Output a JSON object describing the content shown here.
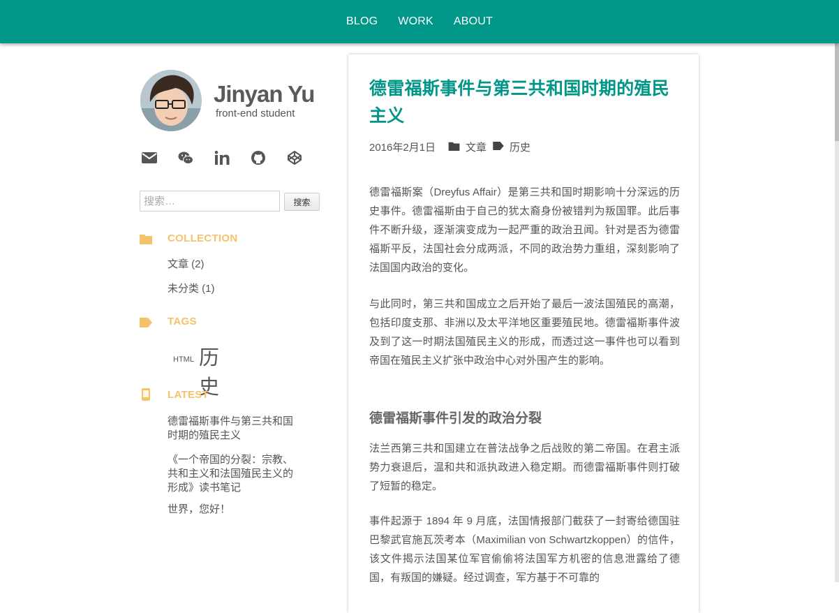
{
  "nav": {
    "items": [
      "BLOG",
      "WORK",
      "ABOUT"
    ]
  },
  "profile": {
    "name": "Jinyan Yu",
    "role": "front-end student"
  },
  "social": [
    "mail-icon",
    "wechat-icon",
    "linkedin-icon",
    "github-icon",
    "codepen-icon"
  ],
  "search": {
    "placeholder": "搜索…",
    "button": "搜索"
  },
  "sections": {
    "collection": {
      "title": "COLLECTION",
      "items": [
        "文章 (2)",
        "未分类 (1)"
      ]
    },
    "tags": {
      "title": "TAGS",
      "items": [
        "HTML",
        "历史"
      ]
    },
    "latest": {
      "title": "LATEST",
      "items": [
        "德雷福斯事件与第三共和国时期的殖民主义",
        "《一个帝国的分裂：宗教、共和主义和法国殖民主义的形成》读书笔记",
        "世界，您好！"
      ]
    }
  },
  "post": {
    "title": "德雷福斯事件与第三共和国时期的殖民主义",
    "date": "2016年2月1日",
    "category": "文章",
    "tag": "历史",
    "paragraphs": [
      "德雷福斯案（Dreyfus Affair）是第三共和国时期影响十分深远的历史事件。德雷福斯由于自己的犹太裔身份被错判为叛国罪。此后事件不断升级，逐渐演变成为一起严重的政治丑闻。针对是否为德雷福斯平反，法国社会分成两派，不同的政治势力重组，深刻影响了法国国内政治的变化。",
      "与此同时，第三共和国成立之后开始了最后一波法国殖民的高潮，包括印度支那、非洲以及太平洋地区重要殖民地。德雷福斯事件波及到了这一时期法国殖民主义的形成，而透过这一事件也可以看到帝国在殖民主义扩张中政治中心对外围产生的影响。",
      "法兰西第三共和国建立在普法战争之后战败的第二帝国。在君主派势力衰退后，温和共和派执政进入稳定期。而德雷福斯事件则打破了短暂的稳定。",
      "事件起源于 1894 年 9 月底，法国情报部门截获了一封寄给德国驻巴黎武官施瓦茨考本（Maximilian von Schwartzkoppen）的信件，该文件揭示法国某位军官偷偷将法国军方机密的信息泄露给了德国，有叛国的嫌疑。经过调查，军方基于不可靠的"
    ],
    "subheading": "德雷福斯事件引发的政治分裂"
  },
  "colors": {
    "primary": "#009688",
    "accent": "#f5c26b",
    "text": "#555555"
  }
}
